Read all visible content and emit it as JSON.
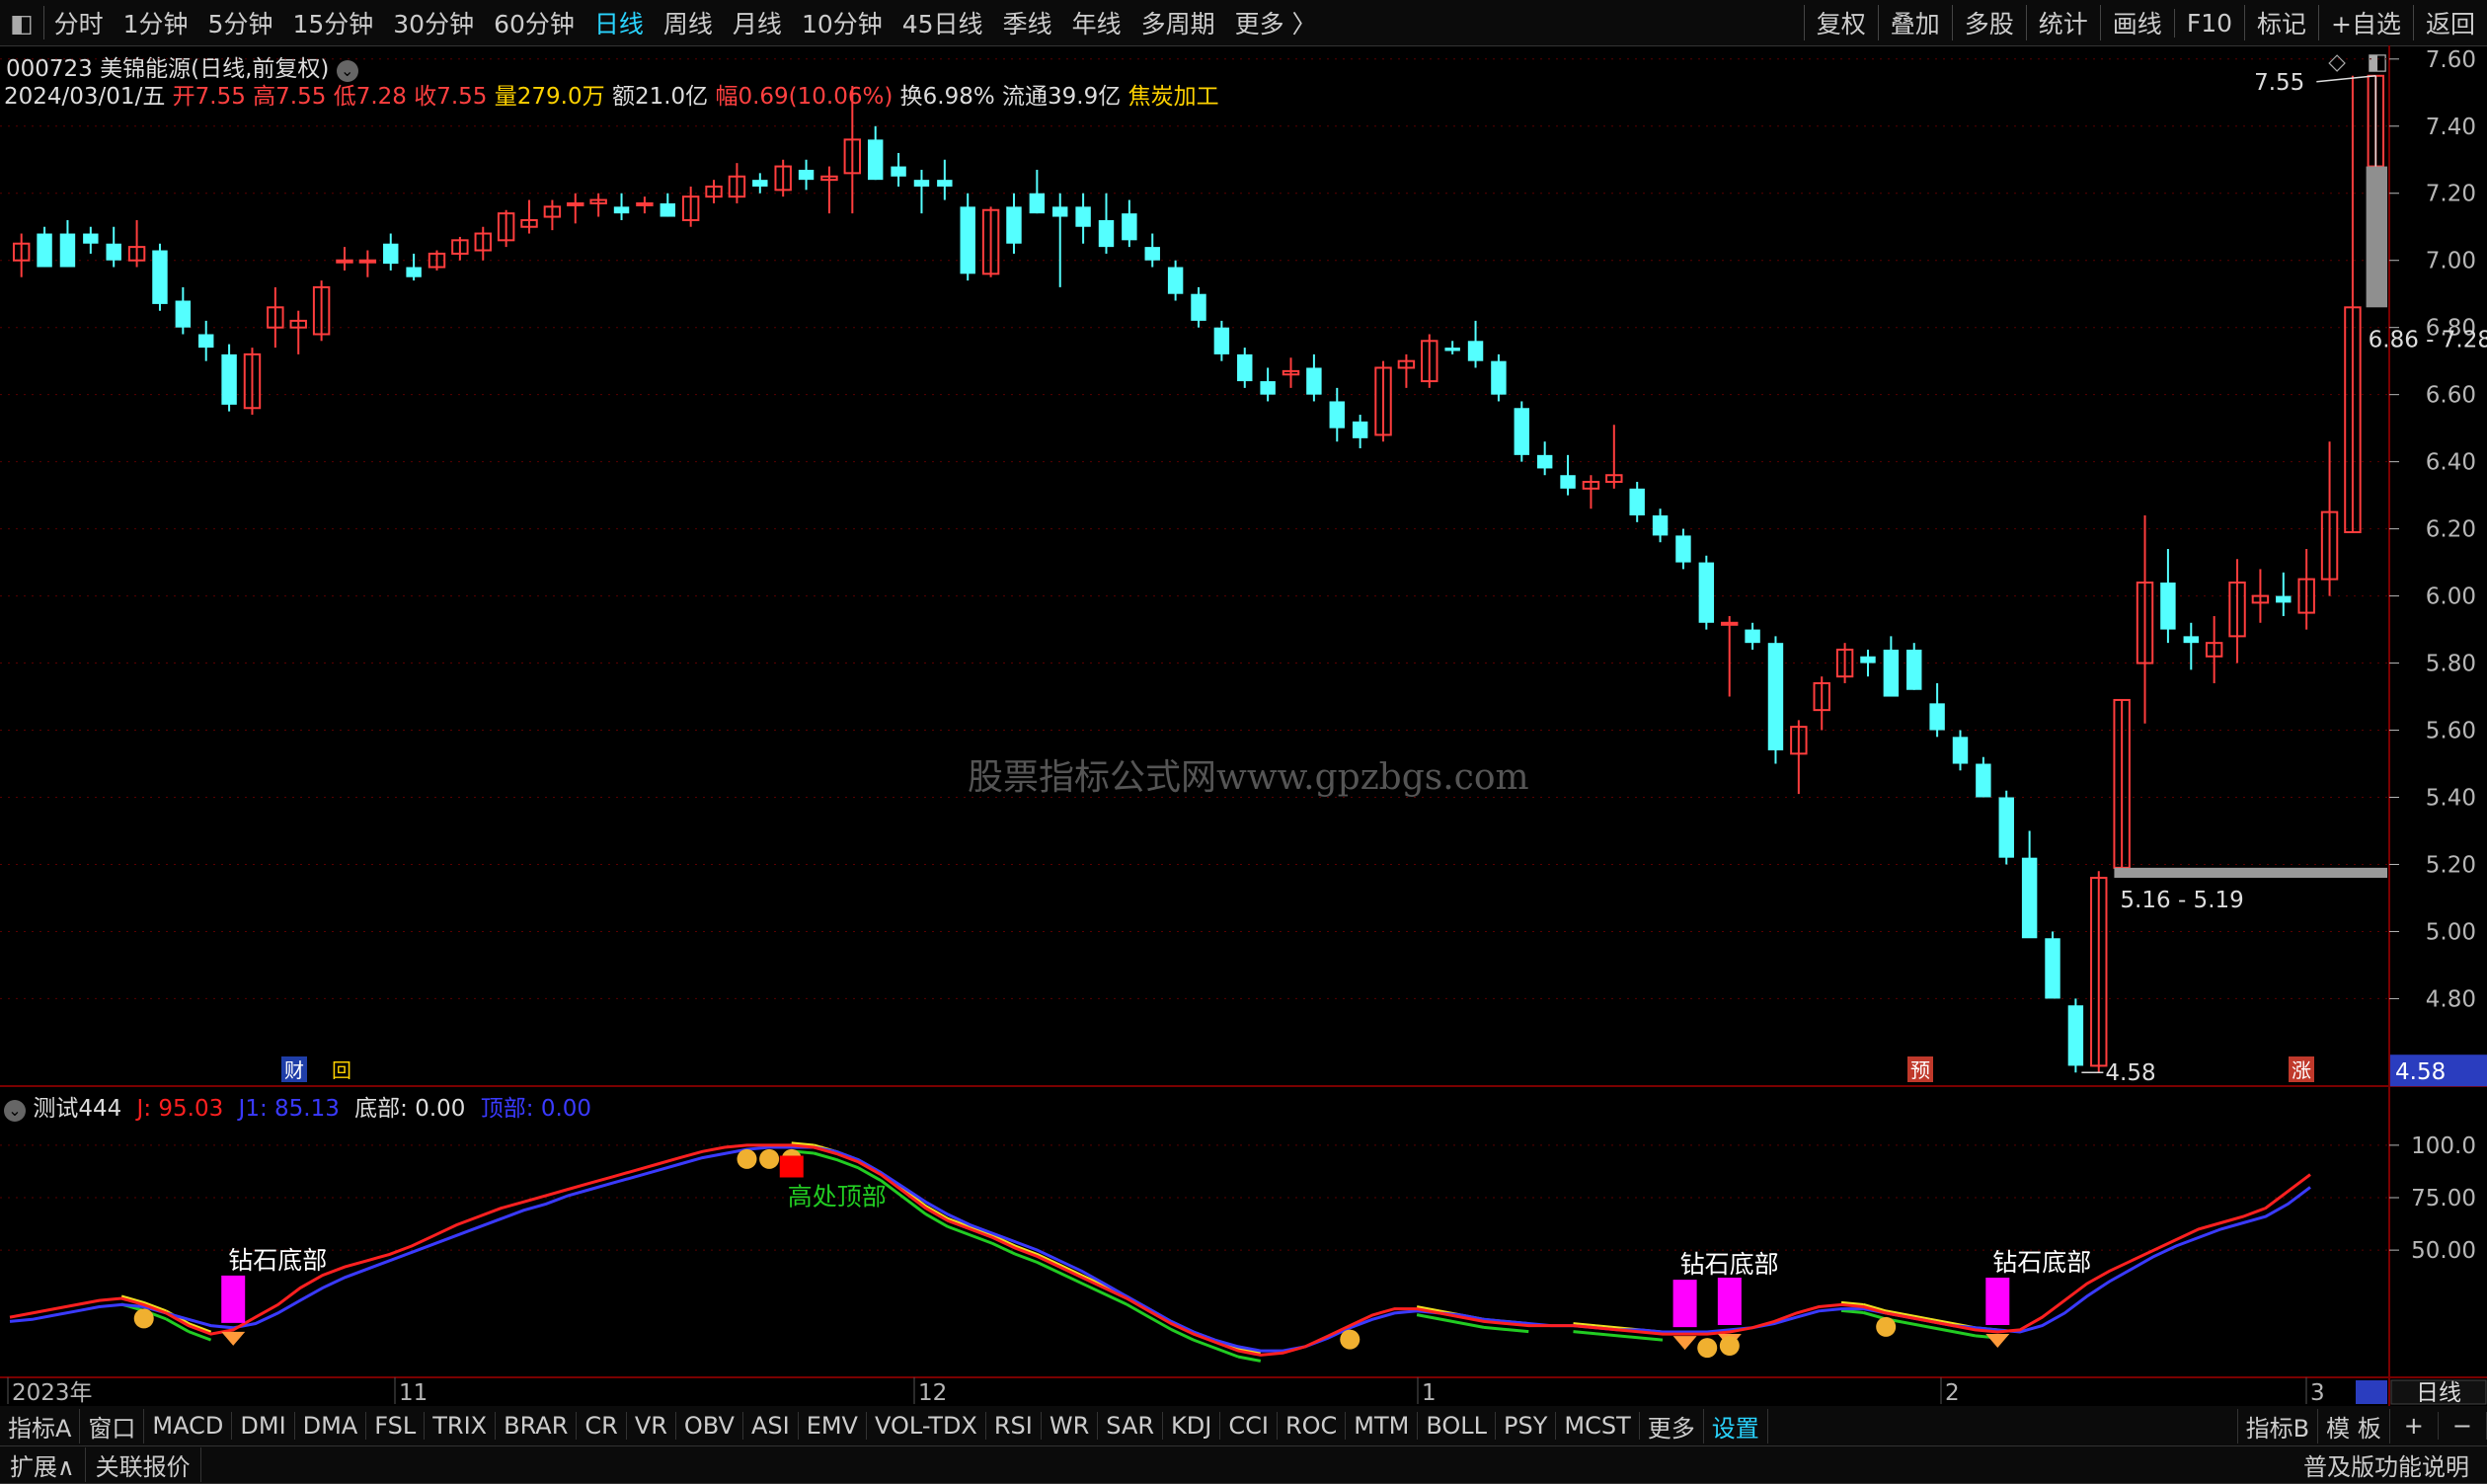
{
  "toolbar": {
    "tabs": [
      "分时",
      "1分钟",
      "5分钟",
      "15分钟",
      "30分钟",
      "60分钟",
      "日线",
      "周线",
      "月线",
      "10分钟",
      "45日线",
      "季线",
      "年线",
      "多周期",
      "更多 〉"
    ],
    "active": "日线",
    "right": [
      "复权",
      "叠加",
      "多股",
      "统计",
      "画线",
      "F10",
      "标记",
      "+自选",
      "返回"
    ]
  },
  "header": {
    "code_name": "000723 美锦能源(日线,前复权)",
    "date": "2024/03/01/五",
    "open": "开7.55",
    "high": "高7.55",
    "low": "低7.28",
    "close": "收7.55",
    "volume": "量279.0万",
    "amount": "额21.0亿",
    "change": "幅0.69(10.06%)",
    "turnover": "换6.98%",
    "float": "流通39.9亿",
    "sector": "焦炭加工"
  },
  "watermark": "股票指标公式网www.gpzbgs.com",
  "colors": {
    "up": "#ff3d3d",
    "down": "#54ffff",
    "axis": "#b7b7b7",
    "grid": "#5a0000",
    "active": "#2ad4ff"
  },
  "markers": {
    "cai": "财",
    "hui": "回",
    "yu": "预",
    "zhang": "涨"
  },
  "chart_data": [
    {
      "type": "candlestick",
      "ylim": [
        4.56,
        7.62
      ],
      "y_ticks": [
        "7.60",
        "7.40",
        "7.20",
        "7.00",
        "6.80",
        "6.60",
        "6.40",
        "6.20",
        "6.00",
        "5.80",
        "5.60",
        "5.40",
        "5.20",
        "5.00",
        "4.80"
      ],
      "candles": [
        [
          7.0,
          7.08,
          6.95,
          7.05
        ],
        [
          7.08,
          7.1,
          6.98,
          6.98
        ],
        [
          7.08,
          7.12,
          6.98,
          6.98
        ],
        [
          7.08,
          7.1,
          7.02,
          7.05
        ],
        [
          7.05,
          7.1,
          6.98,
          7.0
        ],
        [
          7.0,
          7.12,
          6.98,
          7.04
        ],
        [
          7.03,
          7.05,
          6.85,
          6.87
        ],
        [
          6.88,
          6.92,
          6.78,
          6.8
        ],
        [
          6.78,
          6.82,
          6.7,
          6.74
        ],
        [
          6.72,
          6.75,
          6.55,
          6.57
        ],
        [
          6.56,
          6.74,
          6.54,
          6.72
        ],
        [
          6.8,
          6.92,
          6.74,
          6.86
        ],
        [
          6.8,
          6.85,
          6.72,
          6.82
        ],
        [
          6.78,
          6.94,
          6.76,
          6.92
        ],
        [
          7.0,
          7.04,
          6.97,
          7.0
        ],
        [
          7.0,
          7.03,
          6.95,
          7.0
        ],
        [
          7.05,
          7.08,
          6.97,
          6.99
        ],
        [
          6.98,
          7.02,
          6.94,
          6.95
        ],
        [
          6.98,
          7.03,
          6.97,
          7.02
        ],
        [
          7.02,
          7.07,
          7.0,
          7.06
        ],
        [
          7.03,
          7.1,
          7.0,
          7.08
        ],
        [
          7.06,
          7.15,
          7.04,
          7.14
        ],
        [
          7.1,
          7.18,
          7.08,
          7.12
        ],
        [
          7.13,
          7.18,
          7.09,
          7.16
        ],
        [
          7.17,
          7.2,
          7.11,
          7.17
        ],
        [
          7.17,
          7.2,
          7.13,
          7.18
        ],
        [
          7.16,
          7.2,
          7.12,
          7.14
        ],
        [
          7.17,
          7.19,
          7.14,
          7.17
        ],
        [
          7.17,
          7.2,
          7.13,
          7.13
        ],
        [
          7.12,
          7.22,
          7.1,
          7.19
        ],
        [
          7.19,
          7.24,
          7.17,
          7.22
        ],
        [
          7.19,
          7.29,
          7.17,
          7.25
        ],
        [
          7.24,
          7.26,
          7.2,
          7.22
        ],
        [
          7.21,
          7.3,
          7.19,
          7.28
        ],
        [
          7.27,
          7.3,
          7.21,
          7.24
        ],
        [
          7.24,
          7.28,
          7.14,
          7.25
        ],
        [
          7.26,
          7.52,
          7.14,
          7.36
        ],
        [
          7.36,
          7.4,
          7.24,
          7.24
        ],
        [
          7.28,
          7.32,
          7.22,
          7.25
        ],
        [
          7.24,
          7.27,
          7.14,
          7.22
        ],
        [
          7.24,
          7.3,
          7.18,
          7.22
        ],
        [
          7.16,
          7.2,
          6.94,
          6.96
        ],
        [
          6.96,
          7.16,
          6.95,
          7.15
        ],
        [
          7.16,
          7.2,
          7.02,
          7.05
        ],
        [
          7.2,
          7.27,
          7.14,
          7.14
        ],
        [
          7.16,
          7.2,
          6.92,
          7.13
        ],
        [
          7.16,
          7.2,
          7.05,
          7.1
        ],
        [
          7.12,
          7.2,
          7.02,
          7.04
        ],
        [
          7.14,
          7.18,
          7.04,
          7.06
        ],
        [
          7.04,
          7.08,
          6.98,
          7.0
        ],
        [
          6.98,
          7.0,
          6.88,
          6.9
        ],
        [
          6.9,
          6.92,
          6.8,
          6.82
        ],
        [
          6.8,
          6.82,
          6.7,
          6.72
        ],
        [
          6.72,
          6.74,
          6.62,
          6.64
        ],
        [
          6.64,
          6.68,
          6.58,
          6.6
        ],
        [
          6.66,
          6.71,
          6.62,
          6.67
        ],
        [
          6.68,
          6.72,
          6.58,
          6.6
        ],
        [
          6.58,
          6.62,
          6.46,
          6.5
        ],
        [
          6.52,
          6.54,
          6.44,
          6.47
        ],
        [
          6.48,
          6.7,
          6.46,
          6.68
        ],
        [
          6.68,
          6.72,
          6.62,
          6.7
        ],
        [
          6.64,
          6.78,
          6.62,
          6.76
        ],
        [
          6.74,
          6.76,
          6.72,
          6.73
        ],
        [
          6.76,
          6.82,
          6.68,
          6.7
        ],
        [
          6.7,
          6.72,
          6.58,
          6.6
        ],
        [
          6.56,
          6.58,
          6.4,
          6.42
        ],
        [
          6.42,
          6.46,
          6.36,
          6.38
        ],
        [
          6.36,
          6.42,
          6.3,
          6.32
        ],
        [
          6.32,
          6.36,
          6.26,
          6.34
        ],
        [
          6.34,
          6.51,
          6.32,
          6.36
        ],
        [
          6.32,
          6.34,
          6.22,
          6.24
        ],
        [
          6.24,
          6.26,
          6.16,
          6.18
        ],
        [
          6.18,
          6.2,
          6.08,
          6.1
        ],
        [
          6.1,
          6.12,
          5.9,
          5.92
        ],
        [
          5.92,
          5.94,
          5.7,
          5.92
        ],
        [
          5.9,
          5.92,
          5.84,
          5.86
        ],
        [
          5.86,
          5.88,
          5.5,
          5.54
        ],
        [
          5.53,
          5.63,
          5.41,
          5.61
        ],
        [
          5.66,
          5.76,
          5.6,
          5.74
        ],
        [
          5.76,
          5.86,
          5.74,
          5.84
        ],
        [
          5.82,
          5.84,
          5.76,
          5.8
        ],
        [
          5.84,
          5.88,
          5.76,
          5.7
        ],
        [
          5.84,
          5.86,
          5.72,
          5.72
        ],
        [
          5.68,
          5.74,
          5.58,
          5.6
        ],
        [
          5.58,
          5.6,
          5.48,
          5.5
        ],
        [
          5.5,
          5.52,
          5.4,
          5.4
        ],
        [
          5.4,
          5.42,
          5.2,
          5.22
        ],
        [
          5.22,
          5.3,
          5.0,
          4.98
        ],
        [
          4.98,
          5.0,
          4.82,
          4.8
        ],
        [
          4.78,
          4.8,
          4.58,
          4.6
        ],
        [
          4.6,
          5.18,
          4.58,
          5.16
        ],
        [
          5.19,
          5.69,
          5.19,
          5.69
        ],
        [
          5.8,
          6.24,
          5.62,
          6.04
        ],
        [
          6.04,
          6.14,
          5.86,
          5.9
        ],
        [
          5.88,
          5.92,
          5.78,
          5.86
        ],
        [
          5.82,
          5.94,
          5.74,
          5.86
        ],
        [
          5.88,
          6.11,
          5.8,
          6.04
        ],
        [
          5.98,
          6.08,
          5.92,
          6.0
        ],
        [
          6.0,
          6.07,
          5.94,
          5.98
        ],
        [
          5.95,
          6.14,
          5.9,
          6.05
        ],
        [
          6.05,
          6.46,
          6.0,
          6.25
        ],
        [
          6.19,
          7.55,
          6.19,
          6.86
        ],
        [
          7.28,
          7.55,
          7.28,
          7.55
        ]
      ],
      "annotations": {
        "high": "7.55",
        "low": "4.58",
        "gap1": "5.16 - 5.19",
        "gap2": "6.86 - 7.28",
        "last_price": "4.58"
      }
    },
    {
      "type": "line",
      "title": "测试444",
      "legend": [
        {
          "name": "J: 95.03",
          "color": "#ff2020"
        },
        {
          "name": "J1: 85.13",
          "color": "#3a3aff"
        },
        {
          "name": "底部: 0.00",
          "color": "#dddddd"
        },
        {
          "name": "顶部: 0.00",
          "color": "#3a3aff"
        }
      ],
      "ylim": [
        -5,
        115
      ],
      "y_ticks": [
        "100.0",
        "75.00",
        "50.00"
      ],
      "series": [
        {
          "name": "J",
          "color": "#ff2020",
          "values": [
            18,
            20,
            22,
            24,
            26,
            27,
            24,
            20,
            14,
            10,
            12,
            18,
            24,
            32,
            38,
            42,
            45,
            48,
            52,
            57,
            62,
            66,
            70,
            73,
            76,
            79,
            82,
            85,
            88,
            91,
            94,
            97,
            99,
            100,
            100,
            100,
            99,
            96,
            92,
            86,
            78,
            70,
            64,
            60,
            56,
            51,
            47,
            42,
            37,
            32,
            27,
            21,
            15,
            10,
            6,
            2,
            0,
            1,
            4,
            9,
            14,
            19,
            22,
            22,
            20,
            18,
            16,
            15,
            14,
            14,
            14,
            13,
            12,
            11,
            10,
            10,
            10,
            11,
            13,
            16,
            20,
            23,
            24,
            23,
            20,
            18,
            16,
            14,
            12,
            11,
            12,
            18,
            26,
            34,
            40,
            45,
            50,
            55,
            60,
            63,
            66,
            70,
            78,
            86
          ]
        },
        {
          "name": "J1",
          "color": "#3a3aff",
          "values": [
            16,
            17,
            19,
            21,
            23,
            24,
            23,
            20,
            17,
            14,
            13,
            15,
            20,
            26,
            32,
            37,
            41,
            45,
            49,
            53,
            57,
            61,
            65,
            69,
            72,
            76,
            79,
            82,
            85,
            88,
            91,
            94,
            96,
            98,
            99,
            99,
            99,
            97,
            93,
            87,
            80,
            73,
            67,
            62,
            58,
            54,
            50,
            45,
            40,
            34,
            28,
            22,
            16,
            11,
            7,
            4,
            2,
            2,
            4,
            8,
            13,
            17,
            20,
            21,
            20,
            19,
            17,
            16,
            15,
            14,
            14,
            13,
            12,
            12,
            11,
            11,
            11,
            12,
            13,
            15,
            18,
            21,
            22,
            22,
            20,
            18,
            16,
            14,
            13,
            12,
            11,
            14,
            20,
            28,
            35,
            41,
            47,
            52,
            56,
            60,
            63,
            66,
            72,
            80
          ]
        }
      ],
      "labels": {
        "top": "高处顶部",
        "bottom": "钻石底部"
      }
    }
  ],
  "time_axis": [
    "2023年",
    "11",
    "12",
    "1",
    "2",
    "3"
  ],
  "indicator_tabs": [
    "指标A",
    "窗口",
    "MACD",
    "DMI",
    "DMA",
    "FSL",
    "TRIX",
    "BRAR",
    "CR",
    "VR",
    "OBV",
    "ASI",
    "EMV",
    "VOL-TDX",
    "RSI",
    "WR",
    "SAR",
    "KDJ",
    "CCI",
    "ROC",
    "MTM",
    "BOLL",
    "PSY",
    "MCST",
    "更多",
    "设置"
  ],
  "indicator_tabs_active": "设置",
  "indicator_tabs_right": [
    "指标B",
    "模 板",
    "+",
    "−"
  ],
  "period_box": "日线",
  "footer": {
    "left": [
      "扩展∧",
      "关联报价"
    ],
    "right": "普及版功能说明"
  }
}
